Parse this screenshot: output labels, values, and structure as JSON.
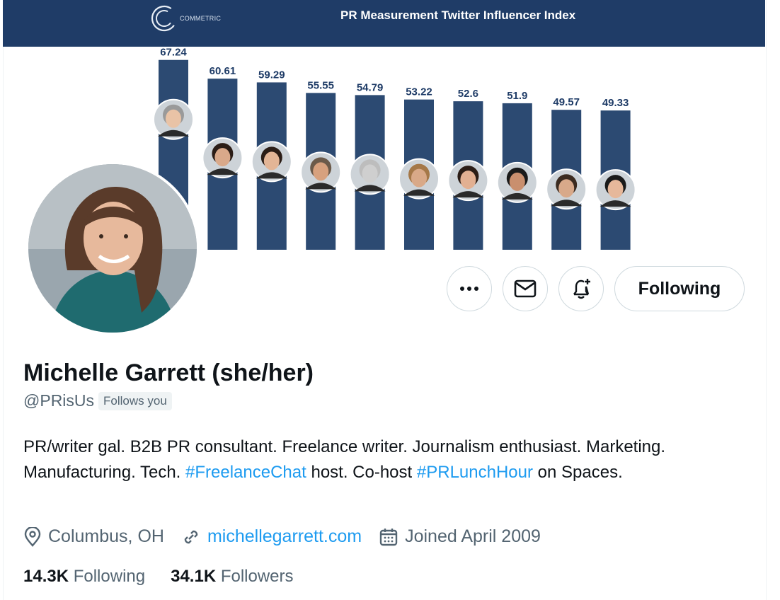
{
  "banner": {
    "brand_text": "COMMETRIC",
    "title": "PR Measurement Twitter Influencer Index",
    "colors": {
      "header_bg": "#1f3c67",
      "bar": "#2c4a72",
      "label": "#1f3c67"
    }
  },
  "chart_data": {
    "type": "bar",
    "values": [
      67.24,
      60.61,
      59.29,
      55.55,
      54.79,
      53.22,
      52.6,
      51.9,
      49.57,
      49.33
    ],
    "labels": [
      "67.24",
      "60.61",
      "59.29",
      "55.55",
      "54.79",
      "53.22",
      "52.6",
      "51.9",
      "49.57",
      "49.33"
    ],
    "ylim": [
      0,
      75
    ],
    "grid": false
  },
  "profile": {
    "name": "Michelle Garrett (she/her)",
    "handle": "@PRisUs",
    "follows_you": "Follows you",
    "bio": {
      "part1": "PR/writer gal. B2B PR consultant. Freelance writer. Journalism enthusiast. Marketing. Manufacturing. Tech. ",
      "hashtag1": "#FreelanceChat",
      "part2": " host. Co-host ",
      "hashtag2": "#PRLunchHour",
      "part3": " on Spaces."
    },
    "location": "Columbus, OH",
    "website": "michellegarrett.com",
    "joined": "Joined April 2009",
    "following_count": "14.3K",
    "following_label": "Following",
    "followers_count": "34.1K",
    "followers_label": "Followers"
  },
  "actions": {
    "more_icon": "more-icon",
    "message_icon": "mail-icon",
    "notify_icon": "bell-plus-icon",
    "following_label": "Following"
  },
  "colors": {
    "link": "#1d9bf0",
    "secondary": "#536471",
    "primary": "#0f1419"
  }
}
